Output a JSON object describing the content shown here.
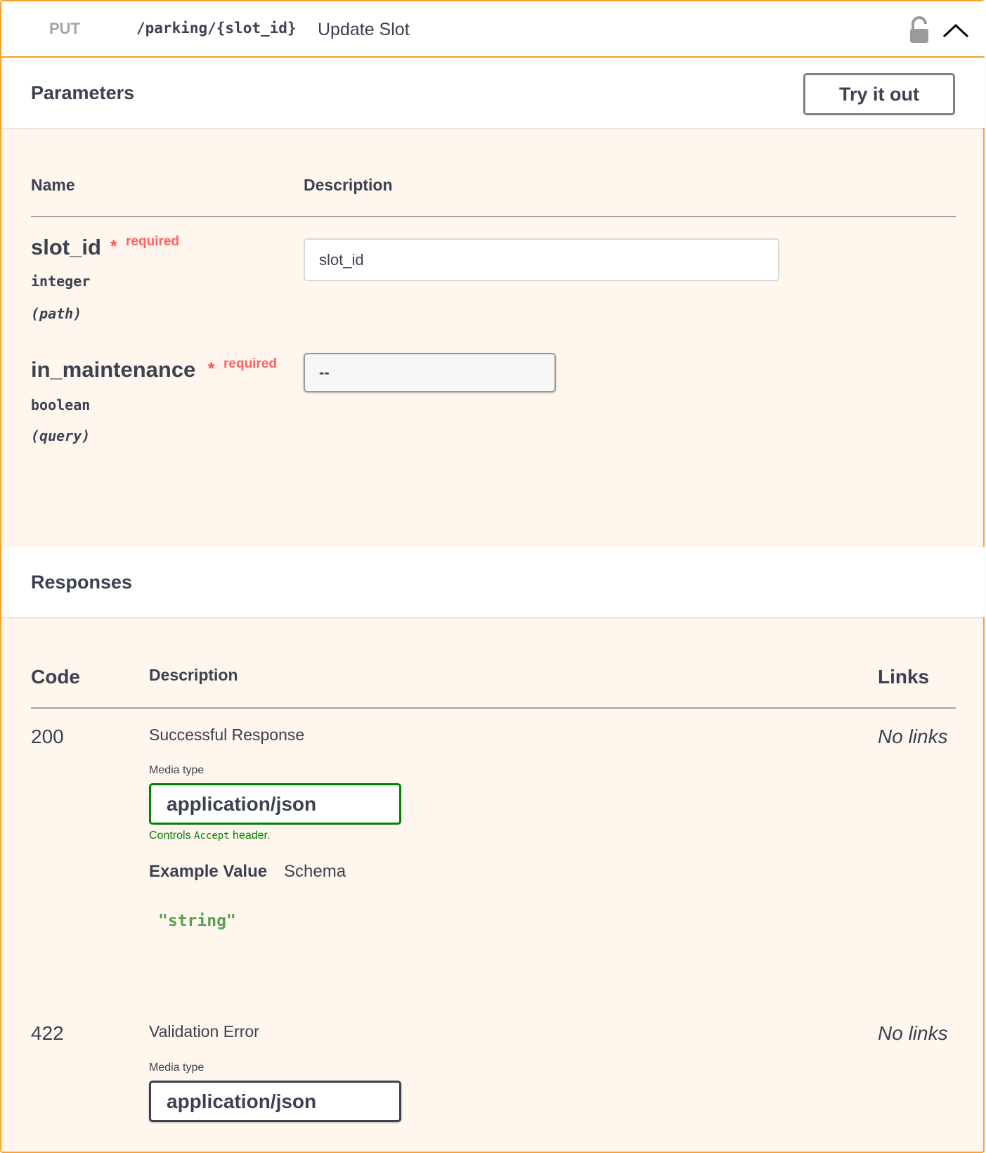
{
  "operation": {
    "method": "PUT",
    "path": "/parking/{slot_id}",
    "summary": "Update Slot",
    "accent_color": "#fca130"
  },
  "parameters": {
    "title": "Parameters",
    "try_it_out_label": "Try it out",
    "columns": {
      "name": "Name",
      "description": "Description"
    },
    "items": [
      {
        "name": "slot_id",
        "required_star": "*",
        "required_label": "required",
        "type": "integer",
        "in": "(path)",
        "input_placeholder": "slot_id"
      },
      {
        "name": "in_maintenance",
        "required_star": "*",
        "required_label": "required",
        "type": "boolean",
        "in": "(query)",
        "select_value": "--"
      }
    ]
  },
  "responses": {
    "title": "Responses",
    "columns": {
      "code": "Code",
      "description": "Description",
      "links": "Links"
    },
    "items": [
      {
        "code": "200",
        "description": "Successful Response",
        "links": "No links",
        "media_type_label": "Media type",
        "media_type": "application/json",
        "controls_prefix": "Controls ",
        "controls_code": "Accept",
        "controls_suffix": " header.",
        "tab_example": "Example Value",
        "tab_schema": "Schema",
        "example": "\"string\""
      },
      {
        "code": "422",
        "description": "Validation Error",
        "links": "No links",
        "media_type_label": "Media type",
        "media_type": "application/json"
      }
    ]
  },
  "icons": {
    "lock": "unlocked-padlock-icon",
    "collapse": "chevron-up-icon"
  }
}
